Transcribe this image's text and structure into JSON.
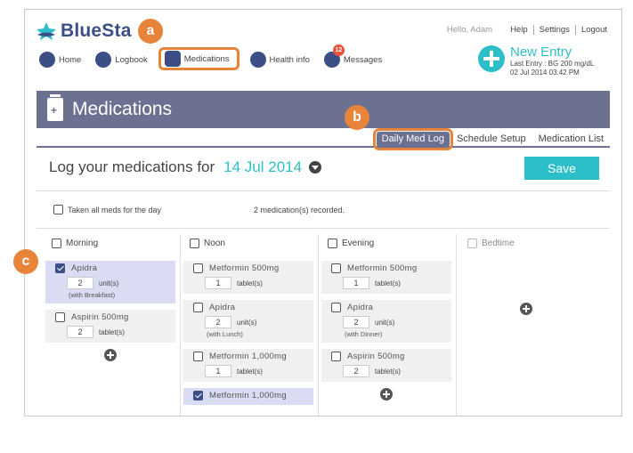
{
  "app": {
    "name": "BlueStar",
    "name_visible": "BlueSta"
  },
  "toplinks": {
    "greeting": "Hello, Adam",
    "help": "Help",
    "settings": "Settings",
    "logout": "Logout"
  },
  "nav": [
    {
      "label": "Home",
      "icon": "home-icon"
    },
    {
      "label": "Logbook",
      "icon": "logbook-icon"
    },
    {
      "label": "Medications",
      "icon": "medications-icon",
      "active": true
    },
    {
      "label": "Health info",
      "icon": "heart-icon"
    },
    {
      "label": "Messages",
      "icon": "messages-icon",
      "badge": "12"
    }
  ],
  "new_entry": {
    "title": "New Entry",
    "last_entry": "Last Entry : BG 200 mg/dL",
    "last_date": "02 Jul 2014 03:42 PM"
  },
  "header": {
    "title": "Medications"
  },
  "tabs": [
    {
      "label": "Daily Med Log",
      "active": true
    },
    {
      "label": "Schedule Setup"
    },
    {
      "label": "Medication List"
    }
  ],
  "log": {
    "label": "Log your medications for",
    "date": "14 Jul 2014",
    "save": "Save"
  },
  "taken_all": "Taken all meds for the day",
  "recorded": "2 medication(s) recorded.",
  "columns": {
    "morning": {
      "label": "Morning",
      "meds": [
        {
          "name": "Apidra",
          "qty": "2",
          "unit": "unit(s)",
          "note": "(with Breakfast)",
          "checked": true
        },
        {
          "name": "Aspirin 500mg",
          "qty": "2",
          "unit": "tablet(s)",
          "note": "",
          "checked": false
        }
      ]
    },
    "noon": {
      "label": "Noon",
      "meds": [
        {
          "name": "Metformin 500mg",
          "qty": "1",
          "unit": "tablet(s)",
          "note": "",
          "checked": false
        },
        {
          "name": "Apidra",
          "qty": "2",
          "unit": "unit(s)",
          "note": "(with Lunch)",
          "checked": false
        },
        {
          "name": "Metformin 1,000mg",
          "qty": "1",
          "unit": "tablet(s)",
          "note": "",
          "checked": false
        },
        {
          "name": "Metformin 1,000mg",
          "qty": "",
          "unit": "",
          "note": "",
          "checked": true
        }
      ]
    },
    "evening": {
      "label": "Evening",
      "meds": [
        {
          "name": "Metformin 500mg",
          "qty": "1",
          "unit": "tablet(s)",
          "note": "",
          "checked": false
        },
        {
          "name": "Apidra",
          "qty": "2",
          "unit": "unit(s)",
          "note": "(with Dinner)",
          "checked": false
        },
        {
          "name": "Aspirin 500mg",
          "qty": "2",
          "unit": "tablet(s)",
          "note": "",
          "checked": false
        }
      ]
    },
    "bedtime": {
      "label": "Bedtime",
      "meds": []
    }
  },
  "callouts": {
    "a": "a",
    "b": "b",
    "c": "c"
  },
  "colors": {
    "brand": "#3b4f86",
    "accent": "#2dbfc9",
    "header": "#6c7191",
    "callout": "#e8833a"
  }
}
